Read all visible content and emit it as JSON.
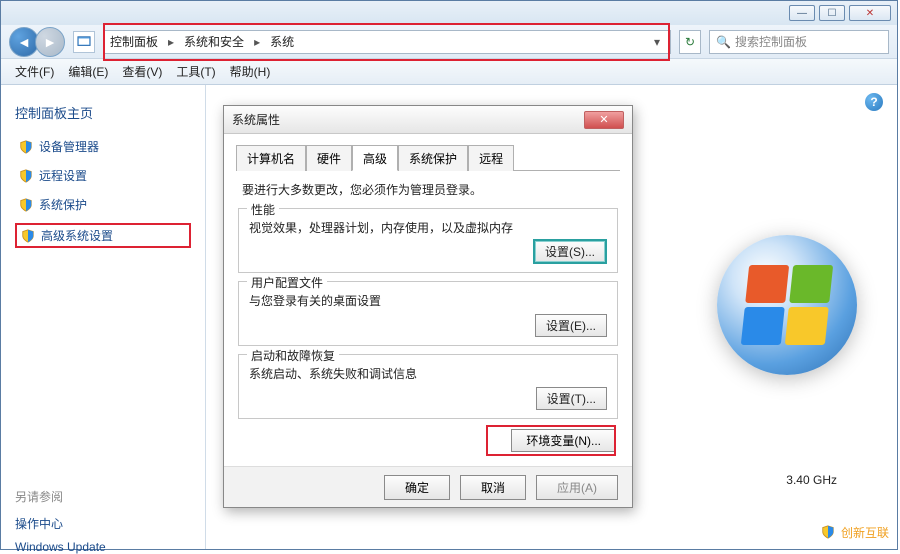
{
  "titlebar": {
    "min": "—",
    "max": "☐",
    "close": "✕"
  },
  "nav": {
    "crumbs": [
      "控制面板",
      "系统和安全",
      "系统"
    ],
    "search_placeholder": "搜索控制面板"
  },
  "menu": {
    "file": "文件(F)",
    "edit": "编辑(E)",
    "view": "查看(V)",
    "tools": "工具(T)",
    "help": "帮助(H)"
  },
  "sidebar": {
    "home": "控制面板主页",
    "items": [
      {
        "label": "设备管理器"
      },
      {
        "label": "远程设置"
      },
      {
        "label": "系统保护"
      },
      {
        "label": "高级系统设置"
      }
    ],
    "see_also": "另请参阅",
    "see_links": [
      {
        "label": "操作中心"
      },
      {
        "label": "Windows Update"
      }
    ]
  },
  "main": {
    "cpu_freq": "3.40 GHz"
  },
  "dialog": {
    "title": "系统属性",
    "tabs": {
      "computer_name": "计算机名",
      "hardware": "硬件",
      "advanced": "高级",
      "system_protection": "系统保护",
      "remote": "远程"
    },
    "admin_note": "要进行大多数更改，您必须作为管理员登录。",
    "perf": {
      "title": "性能",
      "text": "视觉效果，处理器计划，内存使用，以及虚拟内存",
      "btn": "设置(S)..."
    },
    "profile": {
      "title": "用户配置文件",
      "text": "与您登录有关的桌面设置",
      "btn": "设置(E)..."
    },
    "startup": {
      "title": "启动和故障恢复",
      "text": "系统启动、系统失败和调试信息",
      "btn": "设置(T)..."
    },
    "env_btn": "环境变量(N)...",
    "ok": "确定",
    "cancel": "取消",
    "apply": "应用(A)"
  },
  "watermark": "创新互联"
}
